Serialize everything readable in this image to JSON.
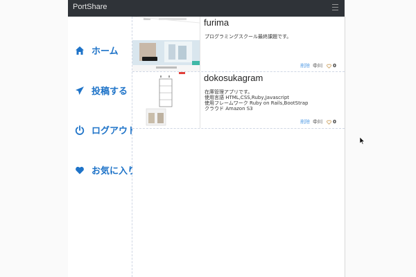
{
  "app": {
    "brand": "PortShare"
  },
  "icons": {
    "menu": "menu-icon",
    "home": "home-icon",
    "post": "paper-plane-icon",
    "logout": "power-icon",
    "favorite": "heart-icon",
    "like": "heart-outline-icon",
    "pointer": "mouse-pointer-icon"
  },
  "colors": {
    "navbar": "#2f3338",
    "accent": "#1e73c8",
    "delete": "#5aa0e6",
    "like_heart": "#c89a55"
  },
  "sidebar": {
    "items": [
      {
        "label": "ホーム"
      },
      {
        "label": "投稿する"
      },
      {
        "label": "ログアウト"
      },
      {
        "label": "お気に入り"
      }
    ]
  },
  "posts": [
    {
      "title": "furima",
      "description": [
        "プログラミングスクール最終課題です。"
      ],
      "delete_label": "削除",
      "author": "中川",
      "likes": "0"
    },
    {
      "title": "dokosukagram",
      "description": [
        "在庫管理アプリです。",
        "使用言語 HTML,CSS,Ruby,Javascript",
        "使用フレームワーク Ruby on Rails,BootStrap",
        "クラウド Amazon S3"
      ],
      "delete_label": "削除",
      "author": "中川",
      "likes": "0"
    }
  ]
}
